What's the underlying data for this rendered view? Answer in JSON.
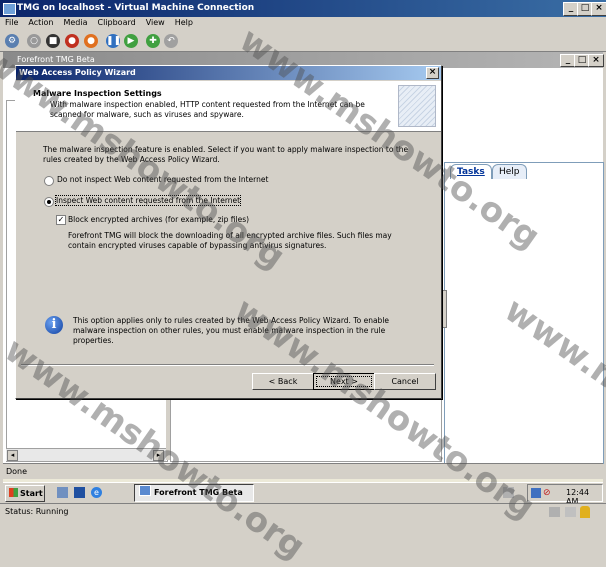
{
  "vm_window": {
    "title": "TMG on localhost - Virtual Machine Connection",
    "menu": [
      "File",
      "Action",
      "Media",
      "Clipboard",
      "View",
      "Help"
    ]
  },
  "tmg_window": {
    "title": "Forefront TMG Beta"
  },
  "dialog": {
    "title": "Web Access Policy Wizard",
    "header_title": "Malware Inspection Settings",
    "header_desc": "With malware inspection enabled, HTTP content requested from the Internet can be scanned for malware, such as viruses and spyware.",
    "intro": "The malware inspection feature is enabled. Select if you want to apply malware inspection to the rules created by the Web Access Policy Wizard.",
    "option_no": "Do not inspect Web content requested from the Internet",
    "option_yes": "Inspect Web content requested from the Internet",
    "block_label": "Block encrypted archives (for example, zip files)",
    "block_desc": "Forefront TMG will block the downloading of all encrypted archive files. Such files may contain encrypted viruses capable of bypassing antivirus signatures.",
    "info_text": "This option applies only to rules created by the Web Access Policy Wizard. To enable malware inspection on other rules, you must enable malware inspection in the rule properties.",
    "back_label": "< Back",
    "next_label": "Next >",
    "cancel_label": "Cancel",
    "selected_option": "yes",
    "block_checked": true
  },
  "task_pane": {
    "tabs": [
      "Tasks",
      "Help"
    ]
  },
  "inner_status": "Done",
  "taskbar": {
    "start_label": "Start",
    "task_label": "Forefront TMG Beta",
    "clock": "12:44 AM"
  },
  "host_status": "Status: Running",
  "watermark": "www.mshowto.org"
}
